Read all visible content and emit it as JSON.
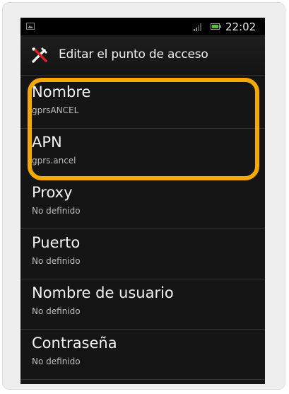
{
  "status_bar": {
    "time": "22:02",
    "icons": [
      "image-icon",
      "signal-icon",
      "battery-icon"
    ],
    "battery_color": "#4fc733"
  },
  "header": {
    "title": "Editar el punto de acceso",
    "icon": "tools-icon"
  },
  "settings": [
    {
      "title": "Nombre",
      "value": "gprsANCEL"
    },
    {
      "title": "APN",
      "value": "gprs.ancel"
    },
    {
      "title": "Proxy",
      "value": "No definido"
    },
    {
      "title": "Puerto",
      "value": "No definido"
    },
    {
      "title": "Nombre de usuario",
      "value": "No definido"
    },
    {
      "title": "Contraseña",
      "value": "No definido"
    }
  ],
  "highlight": {
    "color": "#f5a900",
    "covers": [
      "Nombre",
      "APN"
    ]
  }
}
